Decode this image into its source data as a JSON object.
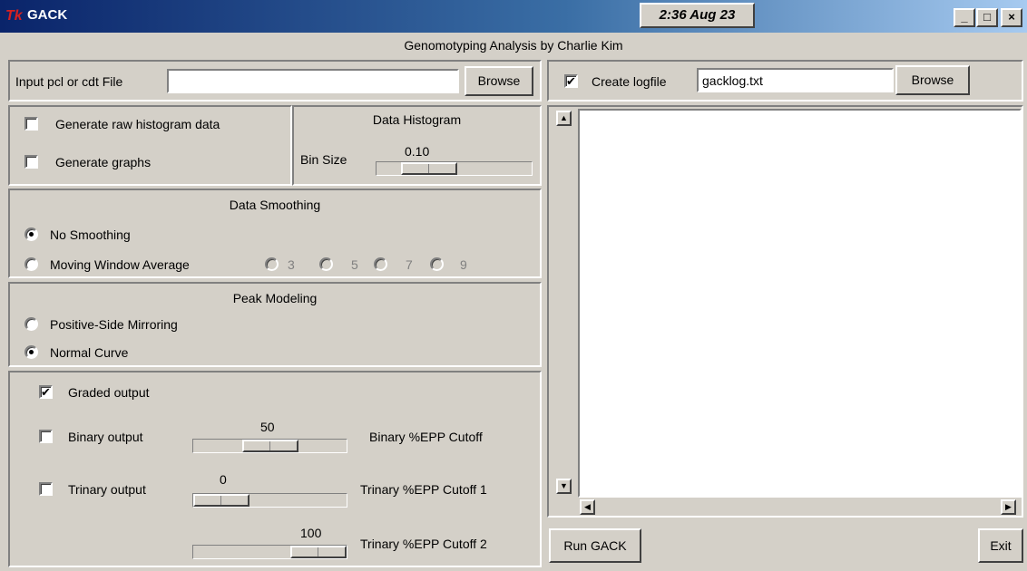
{
  "window": {
    "app_icon": "Tk",
    "title": "GACK",
    "clock": "2:36 Aug 23",
    "heading": "Genomotyping Analysis by Charlie Kim",
    "minimize": "_",
    "maximize": "□",
    "close": "×"
  },
  "input": {
    "label": "Input pcl or cdt File",
    "value": "",
    "browse_label": "Browse"
  },
  "histogram": {
    "raw_label": "Generate raw histogram data",
    "raw_checked": false,
    "graphs_label": "Generate graphs",
    "graphs_checked": false,
    "title": "Data Histogram",
    "bin_label": "Bin Size",
    "bin_value": "0.10"
  },
  "smoothing": {
    "title": "Data Smoothing",
    "none_label": "No Smoothing",
    "moving_label": "Moving Window Average",
    "windows": [
      "3",
      "5",
      "7",
      "9"
    ],
    "selected": "No Smoothing"
  },
  "peak": {
    "title": "Peak Modeling",
    "mirror_label": "Positive-Side Mirroring",
    "normal_label": "Normal Curve",
    "selected": "Normal Curve"
  },
  "output": {
    "graded_label": "Graded output",
    "graded_checked": true,
    "binary_label": "Binary output",
    "binary_checked": false,
    "binary_value": "50",
    "binary_level": 0.5,
    "binary_cutoff_label": "Binary %EPP Cutoff",
    "trinary_label": "Trinary output",
    "trinary_checked": false,
    "trinary_value1": "0",
    "trinary_level1": 0,
    "trinary_cutoff1_label": "Trinary %EPP Cutoff 1",
    "trinary_value2": "100",
    "trinary_level2": 1,
    "trinary_cutoff2_label": "Trinary %EPP Cutoff 2"
  },
  "log": {
    "create_label": "Create logfile",
    "create_checked": true,
    "filename": "gacklog.txt",
    "browse_label": "Browse",
    "text": ""
  },
  "actions": {
    "run_label": "Run GACK",
    "exit_label": "Exit"
  },
  "icons": [
    "tk-app-icon",
    "minimize-icon",
    "maximize-icon",
    "close-icon",
    "scroll-up-icon",
    "scroll-down-icon",
    "scroll-left-icon",
    "scroll-right-icon",
    "checkmark-icon"
  ]
}
